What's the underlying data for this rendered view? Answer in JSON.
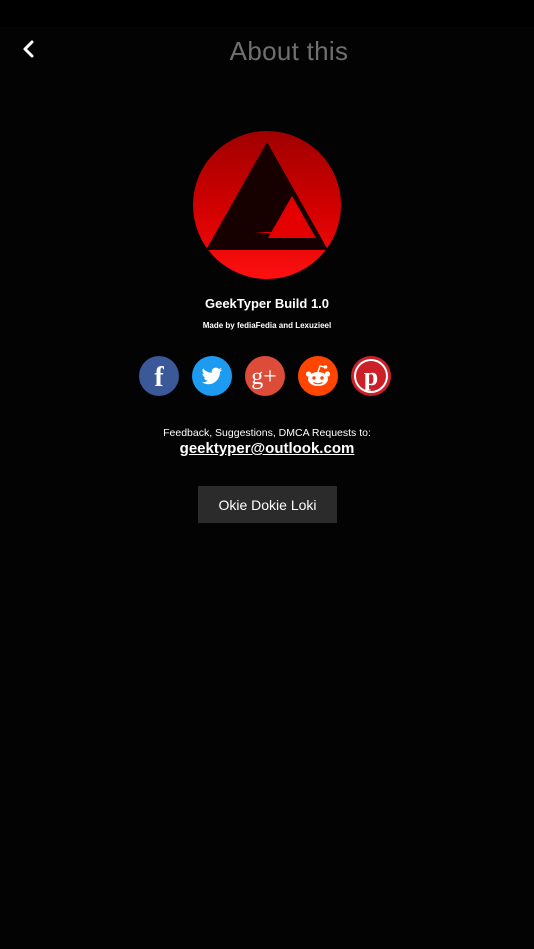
{
  "header": {
    "title": "About this",
    "back_icon": "chevron-left-icon"
  },
  "app": {
    "logo": "app-logo-icon",
    "name": "GeekTyper Build 1.0",
    "credits": "Made by fediaFedia and Lexuzieel"
  },
  "social": {
    "items": [
      {
        "id": "facebook",
        "icon": "facebook-icon",
        "glyph": "f",
        "color": "#3b5998"
      },
      {
        "id": "twitter",
        "icon": "twitter-icon",
        "color": "#1d9bf0"
      },
      {
        "id": "google-plus",
        "icon": "google-plus-icon",
        "glyph": "g+",
        "color": "#dd4b39"
      },
      {
        "id": "reddit",
        "icon": "reddit-icon",
        "color": "#ff4500"
      },
      {
        "id": "pinterest",
        "icon": "pinterest-icon",
        "glyph": "p",
        "color": "#cb2027"
      }
    ]
  },
  "feedback": {
    "label": "Feedback, Suggestions, DMCA Requests to:",
    "email": "geektyper@outlook.com"
  },
  "dialog": {
    "ok_label": "Okie Dokie Loki"
  },
  "colors": {
    "background": "#030303",
    "title_gray": "#6f6f6f",
    "button_bg": "#2b2b2b",
    "logo_red": "#e00000"
  }
}
